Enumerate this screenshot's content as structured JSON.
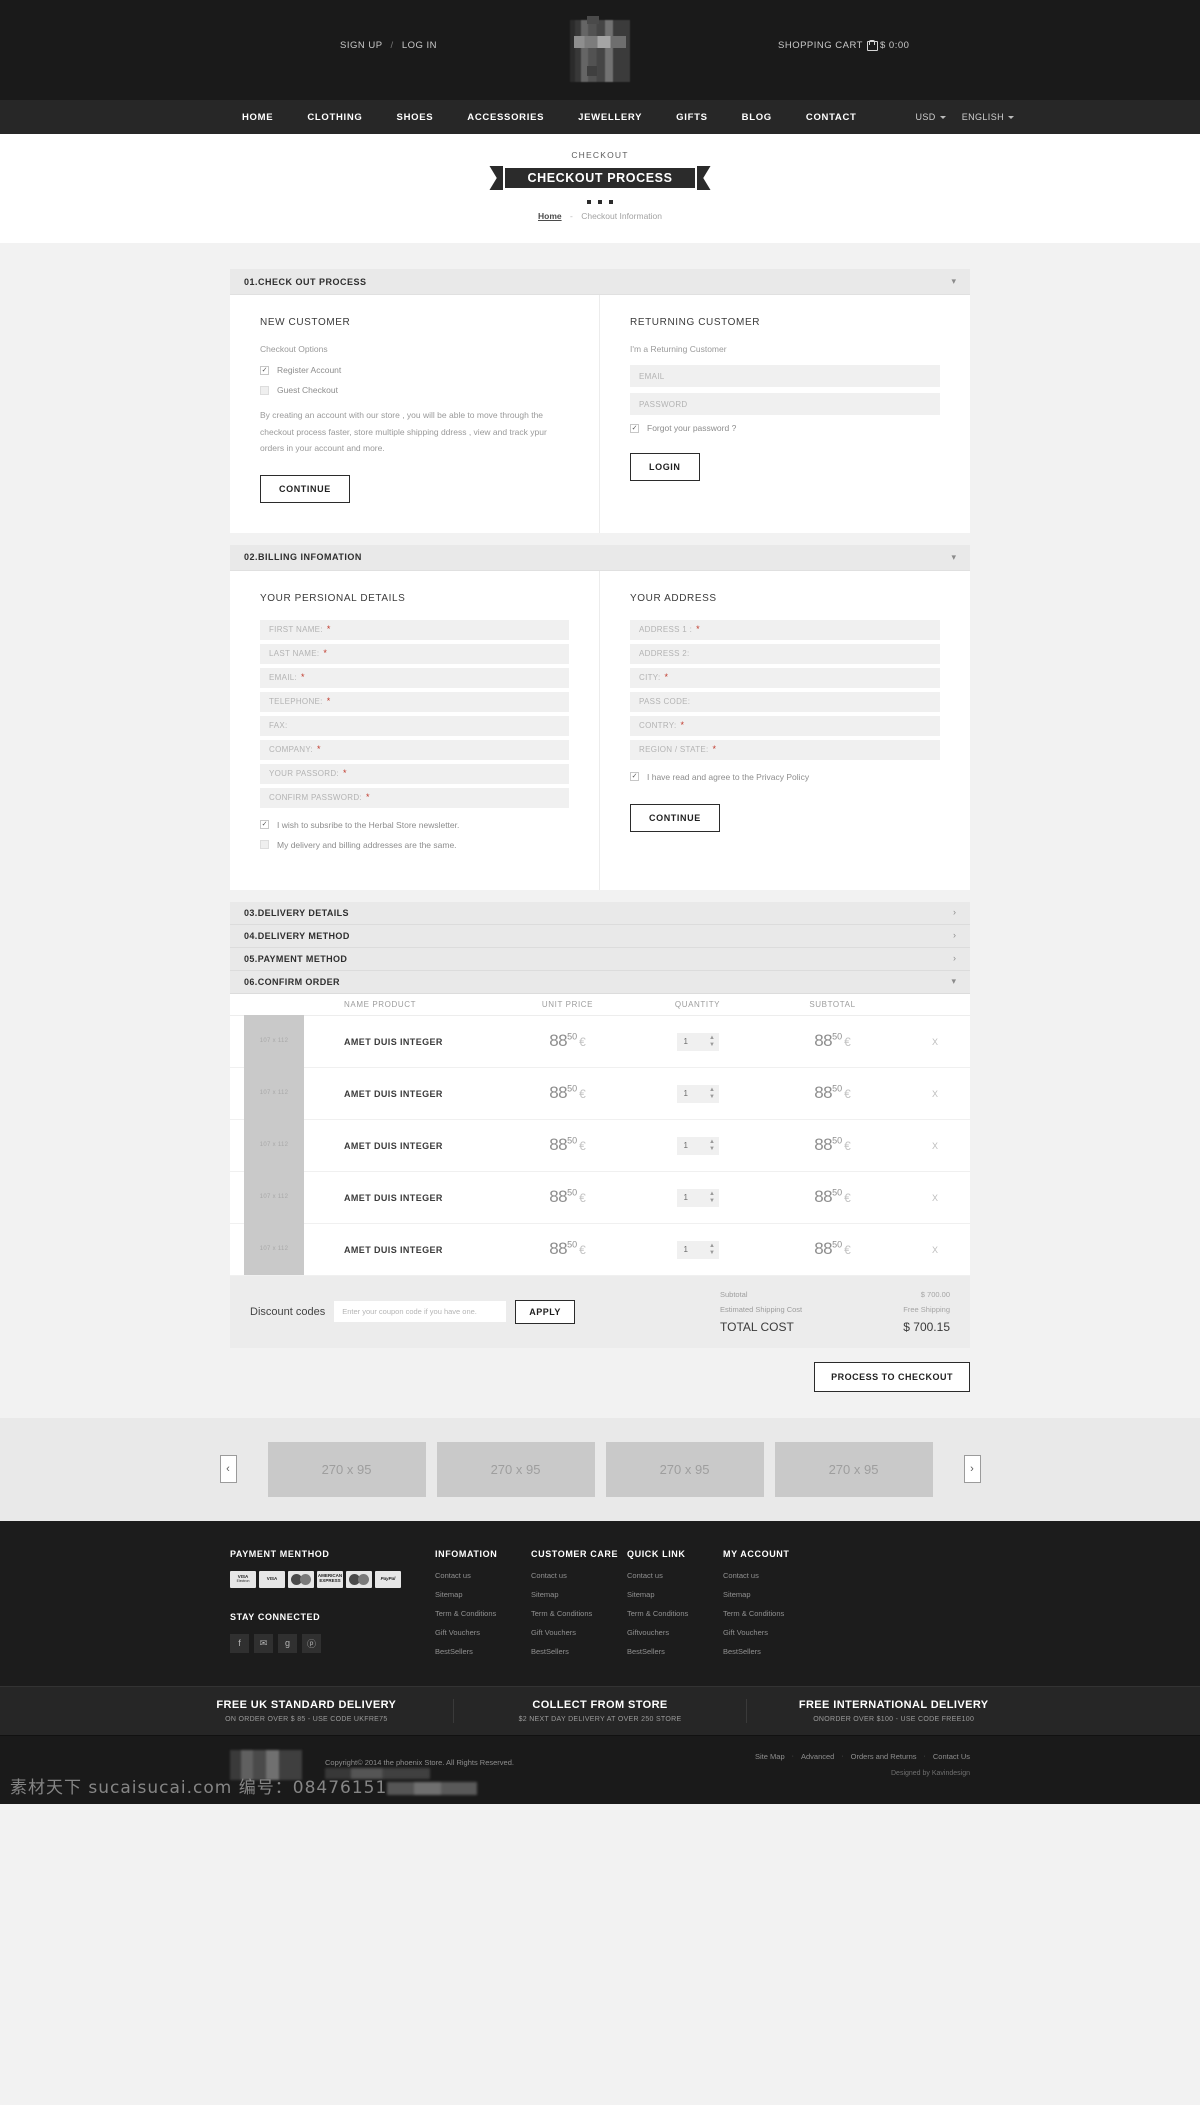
{
  "header": {
    "sign_up": "SIGN UP",
    "separator": "/",
    "log_in": "LOG IN",
    "cart_label": "SHOPPING CART",
    "cart_total": "$ 0:00"
  },
  "nav": {
    "items": [
      {
        "label": "HOME"
      },
      {
        "label": "CLOTHING"
      },
      {
        "label": "SHOES"
      },
      {
        "label": "ACCESSORIES"
      },
      {
        "label": "JEWELLERY"
      },
      {
        "label": "GIFTS"
      },
      {
        "label": "BLOG"
      },
      {
        "label": "CONTACT"
      }
    ],
    "currency": "USD",
    "language": "ENGLISH"
  },
  "page": {
    "eyebrow": "CHECKOUT",
    "ribbon_title": "CHECKOUT PROCESS",
    "breadcrumb_home": "Home",
    "breadcrumb_sep": "-",
    "breadcrumb_current": "Checkout Information"
  },
  "step1": {
    "heading": "01.CHECK OUT PROCESS",
    "new_customer_title": "NEW CUSTOMER",
    "checkout_options_label": "Checkout Options",
    "register_account": "Register Account",
    "guest_checkout": "Guest Checkout",
    "blurb": "By creating an account with our store , you will be able to move through the checkout process faster, store multiple shipping ddress , view and track ypur orders in your account and more.",
    "continue": "CONTINUE",
    "returning_title": "RETURNING CUSTOMER",
    "returning_sub": "I'm a Returning Customer",
    "email_placeholder": "EMAIL",
    "password_placeholder": "PASSWORD",
    "forgot": "Forgot your password ?",
    "login": "LOGIN"
  },
  "step2": {
    "heading": "02.BILLING INFOMATION",
    "personal_title": "YOUR PERSIONAL DETAILS",
    "address_title": "YOUR ADDRESS",
    "personal_fields": [
      {
        "label": "FIRST NAME:",
        "required": true
      },
      {
        "label": "LAST NAME:",
        "required": true
      },
      {
        "label": "EMAIL:",
        "required": true
      },
      {
        "label": "TELEPHONE:",
        "required": true
      },
      {
        "label": "FAX:",
        "required": false
      },
      {
        "label": "COMPANY:",
        "required": true
      },
      {
        "label": "YOUR PASSORD:",
        "required": true
      },
      {
        "label": "CONFIRM PASSWORD:",
        "required": true
      }
    ],
    "address_fields": [
      {
        "label": "ADDRESS 1 :",
        "required": true
      },
      {
        "label": "ADDRESS 2:",
        "required": false
      },
      {
        "label": "CITY:",
        "required": true
      },
      {
        "label": "PASS CODE:",
        "required": false
      },
      {
        "label": "CONTRY:",
        "required": true
      },
      {
        "label": "REGION / STATE:",
        "required": true
      }
    ],
    "newsletter": "I wish to subsribe to the Herbal Store newsletter.",
    "same_address": "My delivery and billing addresses are the same.",
    "privacy": "I have read and agree to the Privacy Policy",
    "continue": "CONTINUE"
  },
  "steps_collapsed": [
    {
      "heading": "03.DELIVERY DETAILS"
    },
    {
      "heading": "04.DELIVERY METHOD"
    },
    {
      "heading": "05.PAYMENT METHOD"
    }
  ],
  "step6": {
    "heading": "06.CONFIRM ORDER"
  },
  "cart_table": {
    "columns": [
      "",
      "NAME PRODUCT",
      "UNIT PRICE",
      "QUANTITY",
      "SUBTOTAL",
      ""
    ],
    "rows": [
      {
        "thumb": "107 x 112",
        "name": "AMET DUIS INTEGER",
        "price_int": "88",
        "price_dec": "50",
        "currency": "€",
        "qty": "1",
        "sub_int": "88",
        "sub_dec": "50",
        "remove": "X"
      },
      {
        "thumb": "107 x 112",
        "name": "AMET DUIS INTEGER",
        "price_int": "88",
        "price_dec": "50",
        "currency": "€",
        "qty": "1",
        "sub_int": "88",
        "sub_dec": "50",
        "remove": "X"
      },
      {
        "thumb": "107 x 112",
        "name": "AMET DUIS INTEGER",
        "price_int": "88",
        "price_dec": "50",
        "currency": "€",
        "qty": "1",
        "sub_int": "88",
        "sub_dec": "50",
        "remove": "X"
      },
      {
        "thumb": "107 x 112",
        "name": "AMET DUIS INTEGER",
        "price_int": "88",
        "price_dec": "50",
        "currency": "€",
        "qty": "1",
        "sub_int": "88",
        "sub_dec": "50",
        "remove": "X"
      },
      {
        "thumb": "107 x 112",
        "name": "AMET DUIS INTEGER",
        "price_int": "88",
        "price_dec": "50",
        "currency": "€",
        "qty": "1",
        "sub_int": "88",
        "sub_dec": "50",
        "remove": "X"
      }
    ]
  },
  "totals": {
    "discount_label": "Discount codes",
    "coupon_placeholder": "Enter your coupon code if you have one.",
    "apply": "APPLY",
    "subtotal_label": "Subtotal",
    "subtotal_value": "$ 700.00",
    "shipping_label": "Estimated Shipping Cost",
    "shipping_value": "Free Shipping",
    "total_label": "TOTAL COST",
    "total_value": "$ 700.15",
    "checkout_button": "PROCESS TO CHECKOUT"
  },
  "carousel": {
    "prev": "‹",
    "next": "›",
    "items": [
      {
        "label": "270 x 95"
      },
      {
        "label": "270 x 95"
      },
      {
        "label": "270 x 95"
      },
      {
        "label": "270 x 95"
      }
    ]
  },
  "footer": {
    "payment_title": "PAYMENT MENTHOD",
    "cards": [
      {
        "name": "VISA",
        "sub": "Electron"
      },
      {
        "name": "VISA",
        "sub": ""
      },
      {
        "name": "mastercard",
        "sub": ""
      },
      {
        "name": "AMERICAN",
        "sub": "EXPRESS"
      },
      {
        "name": "Maestro",
        "sub": ""
      },
      {
        "name": "PayPal",
        "sub": ""
      }
    ],
    "stay_connected_title": "STAY CONNECTED",
    "social": [
      {
        "icon": "facebook-icon",
        "glyph": "f"
      },
      {
        "icon": "twitter-icon",
        "glyph": "✉"
      },
      {
        "icon": "google-plus-icon",
        "glyph": "g"
      },
      {
        "icon": "pinterest-icon",
        "glyph": "ⓟ"
      }
    ],
    "columns": [
      {
        "title": "INFOMATION",
        "links": [
          "Contact us",
          "Sitemap",
          "Term & Conditions",
          "Gift Vouchers",
          "BestSellers"
        ]
      },
      {
        "title": "CUSTOMER CARE",
        "links": [
          "Contact us",
          "Sitemap",
          "Term & Conditions",
          "Gift Vouchers",
          "BestSellers"
        ]
      },
      {
        "title": "QUICK LINK",
        "links": [
          "Contact us",
          "Sitemap",
          "Term & Conditions",
          "Giftvouchers",
          "BestSellers"
        ]
      },
      {
        "title": "MY ACCOUNT",
        "links": [
          "Contact us",
          "Sitemap",
          "Term & Conditions",
          "Gift Vouchers",
          "BestSellers"
        ]
      }
    ]
  },
  "delivery": [
    {
      "title": "FREE UK STANDARD DELIVERY",
      "sub": "ON ORDER OVER $ 85 - USE CODE UKFRE75"
    },
    {
      "title": "COLLECT FROM STORE",
      "sub": "$2 NEXT DAY DELIVERY AT OVER 250 STORE"
    },
    {
      "title": "FREE INTERNATIONAL DELIVERY",
      "sub": "ONORDER OVER $100 - USE CODE FREE100"
    }
  ],
  "copyright": {
    "text": "Copyright© 2014 the phoenix  Store. All Rights Reserved.",
    "links": [
      "Site Map",
      "Advanced",
      "Orders and Returns",
      "Contact Us"
    ],
    "designed": "Designed by Kavindesign"
  },
  "watermark": {
    "text": "素材天下 sucaisucai.com 编号：08476151"
  }
}
